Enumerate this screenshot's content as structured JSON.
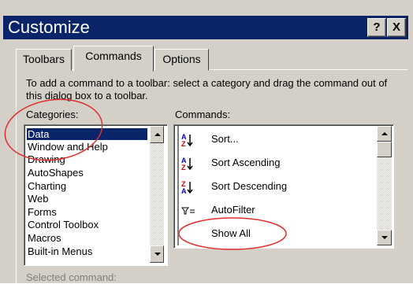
{
  "dialog": {
    "title": "Customize",
    "help_label": "?",
    "close_label": "X"
  },
  "tabs": [
    {
      "label": "Toolbars",
      "active": false
    },
    {
      "label": "Commands",
      "active": true
    },
    {
      "label": "Options",
      "active": false
    }
  ],
  "instructions": "To add a command to a toolbar: select a category and drag the command out of this dialog box to a toolbar.",
  "categories": {
    "label": "Categories:",
    "items": [
      "Data",
      "Window and Help",
      "Drawing",
      "AutoShapes",
      "Charting",
      "Web",
      "Forms",
      "Control Toolbox",
      "Macros",
      "Built-in Menus"
    ],
    "selected": "Data"
  },
  "commands": {
    "label": "Commands:",
    "items": [
      {
        "label": "Sort...",
        "icon": "sort-icon"
      },
      {
        "label": "Sort Ascending",
        "icon": "sort-ascending-icon"
      },
      {
        "label": "Sort Descending",
        "icon": "sort-descending-icon"
      },
      {
        "label": "AutoFilter",
        "icon": "autofilter-icon"
      },
      {
        "label": "Show All",
        "icon": ""
      }
    ]
  },
  "selected_command_label": "Selected command:",
  "annotation_color": "#e03030"
}
